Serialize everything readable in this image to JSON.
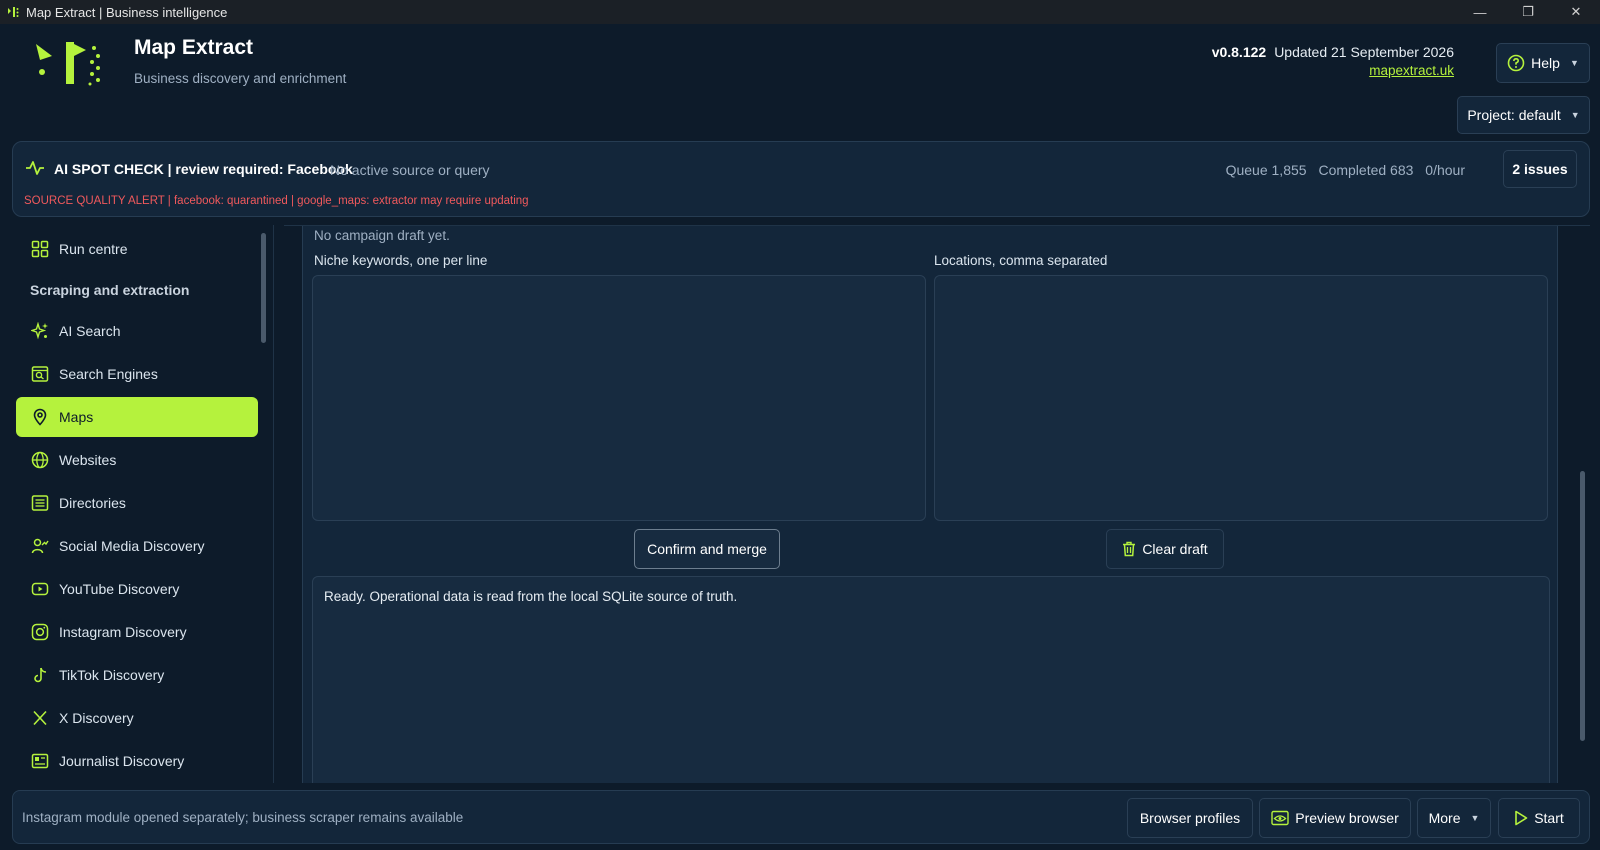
{
  "window": {
    "title": "Map Extract | Business intelligence"
  },
  "header": {
    "app_name": "Map Extract",
    "subtitle": "Business discovery and enrichment",
    "version": "v0.8.122",
    "updated": "Updated 21 September 2026",
    "website": "mapextract.uk",
    "help_label": "Help",
    "project_label": "Project: default"
  },
  "status": {
    "spot_check": "AI SPOT CHECK | review required: Facebook",
    "source_query": "No active source or query",
    "alert": "SOURCE QUALITY ALERT | facebook: quarantined | google_maps: extractor may require updating",
    "queue": "Queue 1,855",
    "completed": "Completed 683",
    "rate": "0/hour",
    "issues_label": "2 issues"
  },
  "sidebar": {
    "items": [
      {
        "label": "Run centre",
        "icon": "grid-icon"
      },
      {
        "label": "AI Search",
        "icon": "sparkle-icon"
      },
      {
        "label": "Search Engines",
        "icon": "search-box-icon"
      },
      {
        "label": "Maps",
        "icon": "map-pin-icon",
        "active": true
      },
      {
        "label": "Websites",
        "icon": "globe-icon"
      },
      {
        "label": "Directories",
        "icon": "list-icon"
      },
      {
        "label": "Social Media Discovery",
        "icon": "user-trend-icon"
      },
      {
        "label": "YouTube Discovery",
        "icon": "youtube-icon"
      },
      {
        "label": "Instagram Discovery",
        "icon": "instagram-icon"
      },
      {
        "label": "TikTok Discovery",
        "icon": "tiktok-icon"
      },
      {
        "label": "X Discovery",
        "icon": "x-icon"
      },
      {
        "label": "Journalist Discovery",
        "icon": "newspaper-icon"
      }
    ],
    "section_label": "Scraping and extraction"
  },
  "main": {
    "no_draft": "No campaign draft yet.",
    "keywords_label": "Niche keywords, one per line",
    "keywords_value": "",
    "locations_label": "Locations, comma separated",
    "locations_value": "",
    "confirm_label": "Confirm and merge",
    "clear_label": "Clear draft",
    "log_text": "Ready. Operational data is read from the local SQLite source of truth."
  },
  "footer": {
    "status_msg": "Instagram module opened separately; business scraper remains available",
    "profiles_label": "Browser profiles",
    "preview_label": "Preview browser",
    "more_label": "More",
    "start_label": "Start"
  },
  "colors": {
    "accent": "#b5f23d",
    "background": "#0d1b2a",
    "panel": "#13263a",
    "alert": "#f0595c"
  }
}
